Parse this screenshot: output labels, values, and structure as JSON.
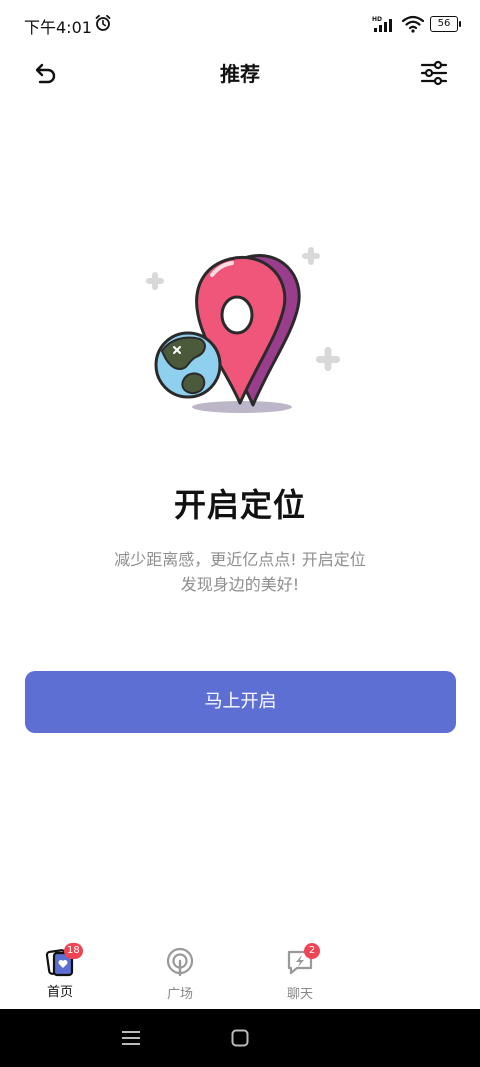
{
  "status_bar": {
    "time": "下午4:01",
    "network": "HD",
    "battery": "56"
  },
  "header": {
    "title": "推荐"
  },
  "main": {
    "heading": "开启定位",
    "description_line1": "减少距离感，更近亿点点! 开启定位",
    "description_line2": "发现身边的美好!",
    "button_label": "马上开启"
  },
  "tabbar": {
    "tabs": [
      {
        "label": "首页",
        "badge": "18"
      },
      {
        "label": "广场"
      },
      {
        "label": "聊天",
        "badge": "2"
      }
    ]
  },
  "colors": {
    "primary_button": "#5d6fd2",
    "badge": "#f04455",
    "pin": "#f0567a",
    "globe": "#8fd0ee"
  }
}
